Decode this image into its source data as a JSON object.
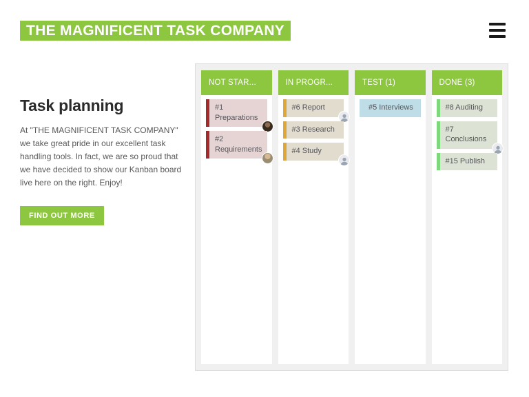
{
  "header": {
    "brand_title": "THE MAGNIFICENT TASK COMPANY",
    "brand_bg_color": "#8dc63f",
    "menu_icon": "hamburger-menu-icon"
  },
  "intro": {
    "title": "Task planning",
    "paragraph": "At \"THE MAGNIFICENT TASK COMPANY\" we take great pride in our excellent task handling tools. In fact, we are so proud that we have decided to show our Kanban board live here on the right. Enjoy!",
    "cta_label": "FIND OUT MORE",
    "cta_color": "#8dc63f"
  },
  "board": {
    "header_color": "#8dc63f",
    "columns": [
      {
        "title": "NOT STAR...",
        "accent": "#a32b2b",
        "card_bg": "#e6d4d4",
        "cards": [
          {
            "text": "#1 Preparations",
            "avatar": "photo-dark"
          },
          {
            "text": "#2 Requirements",
            "avatar": "photo-light"
          }
        ]
      },
      {
        "title": "IN PROGR...",
        "accent": "#dda73a",
        "card_bg": "#e2dccf",
        "cards": [
          {
            "text": "#6 Report",
            "avatar": "generic"
          },
          {
            "text": "#3 Research",
            "avatar": "none"
          },
          {
            "text": "#4 Study",
            "avatar": "generic"
          }
        ]
      },
      {
        "title": "TEST (1)",
        "accent": "#bfdde6",
        "card_bg": "#bfdde6",
        "cards": [
          {
            "text": "#5 Interviews",
            "avatar": "none"
          }
        ]
      },
      {
        "title": "DONE (3)",
        "accent": "#7ed87e",
        "card_bg": "#dde3d4",
        "cards": [
          {
            "text": "#8 Auditing",
            "avatar": "none"
          },
          {
            "text": "#7 Conclusions",
            "avatar": "generic"
          },
          {
            "text": "#15 Publish",
            "avatar": "none"
          }
        ]
      }
    ]
  }
}
